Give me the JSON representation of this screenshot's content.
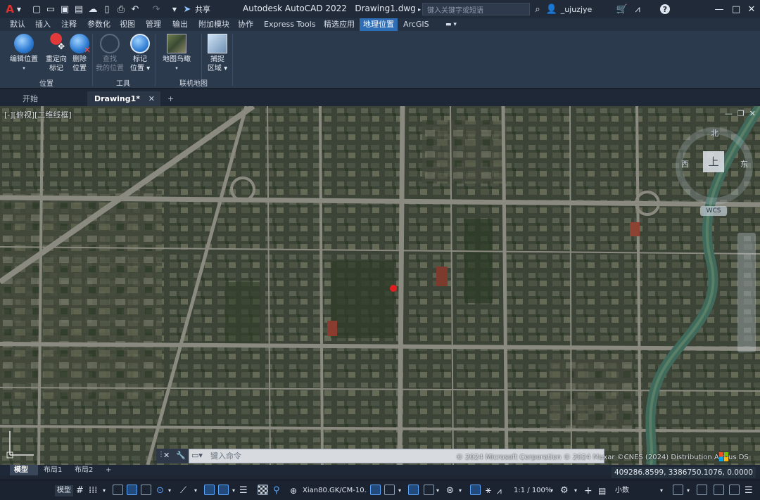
{
  "titlebar": {
    "app_menu": "A",
    "share": "共享",
    "app_title": "Autodesk AutoCAD 2022",
    "file_name": "Drawing1.dwg",
    "search_placeholder": "键入关键字或短语",
    "user": "_ujuzjye",
    "help": "?"
  },
  "menu_tabs": [
    "默认",
    "插入",
    "注释",
    "参数化",
    "视图",
    "管理",
    "输出",
    "附加模块",
    "协作",
    "Express Tools",
    "精选应用",
    "地理位置",
    "ArcGIS"
  ],
  "active_menu_tab": "地理位置",
  "ribbon": {
    "buttons": [
      {
        "line1": "编辑位置",
        "line2": "",
        "disabled": false
      },
      {
        "line1": "重定向",
        "line2": "标记",
        "disabled": false
      },
      {
        "line1": "删除",
        "line2": "位置",
        "disabled": false
      },
      {
        "line1": "查找",
        "line2": "我的位置",
        "disabled": true
      },
      {
        "line1": "标记",
        "line2": "位置",
        "disabled": false
      },
      {
        "line1": "地图鸟瞰",
        "line2": "",
        "disabled": false
      },
      {
        "line1": "捕捉",
        "line2": "区域",
        "disabled": false
      }
    ],
    "panels": [
      "位置",
      "工具",
      "联机地图"
    ]
  },
  "doc_tabs": [
    "开始",
    "Drawing1*"
  ],
  "viewport": {
    "label": "[-][俯视][二维线框]",
    "viewcube": {
      "north": "北",
      "south": "南",
      "west": "西",
      "east": "东",
      "top": "上",
      "wcs": "WCS"
    }
  },
  "command": {
    "placeholder": "键入命令"
  },
  "copyright": "© 2024 Microsoft Corporation © 2024 Maxar ©CNES (2024) Distribution Airbus DS",
  "layout_tabs": [
    "模型",
    "布局1",
    "布局2"
  ],
  "coordinates": "409286.8599, 3386750.1076, 0.0000",
  "statusbar": {
    "model": "模型",
    "coord_system": "Xian80.GK/CM-10...",
    "scale": "1:1 / 100%",
    "units": "小数"
  },
  "colors": {
    "accent": "#2f6db5",
    "title_bg": "#202a38",
    "ribbon_bg": "#2c3a4d"
  }
}
